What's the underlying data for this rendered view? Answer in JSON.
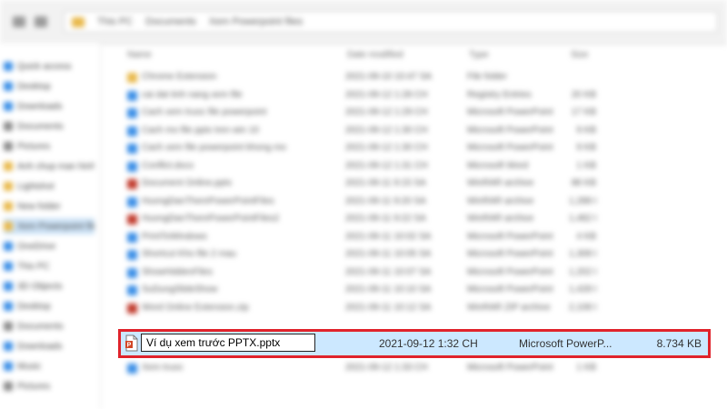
{
  "window": {
    "address_parts": [
      "This PC",
      "Documents",
      "Xem Powerpoint files"
    ],
    "search_placeholder": ""
  },
  "columns": {
    "name": "Name",
    "date": "Date modified",
    "type": "Type",
    "size": "Size"
  },
  "sidebar": {
    "items": [
      {
        "label": "Quick access",
        "color": "#3a8ee6"
      },
      {
        "label": "Desktop",
        "color": "#3a8ee6"
      },
      {
        "label": "Downloads",
        "color": "#3a8ee6"
      },
      {
        "label": "Documents",
        "color": "#8a8a8a"
      },
      {
        "label": "Pictures",
        "color": "#8a8a8a"
      },
      {
        "label": "Anh chup man hinh",
        "color": "#e8b84a"
      },
      {
        "label": "Lightshot",
        "color": "#e8b84a"
      },
      {
        "label": "New folder",
        "color": "#e8b84a"
      },
      {
        "label": "Xem Powerpoint files",
        "color": "#e8b84a"
      },
      {
        "label": "OneDrive",
        "color": "#3a8ee6"
      },
      {
        "label": "This PC",
        "color": "#3a8ee6"
      },
      {
        "label": "3D Objects",
        "color": "#3a8ee6"
      },
      {
        "label": "Desktop",
        "color": "#3a8ee6"
      },
      {
        "label": "Documents",
        "color": "#8a8a8a"
      },
      {
        "label": "Downloads",
        "color": "#3a8ee6"
      },
      {
        "label": "Music",
        "color": "#3a8ee6"
      },
      {
        "label": "Pictures",
        "color": "#8a8a8a"
      }
    ]
  },
  "files": [
    {
      "name": "Chrome Extension",
      "date": "2021-09-10 10:47 SA",
      "type": "File folder",
      "size": "",
      "color": "#e8b84a"
    },
    {
      "name": "cai dat tinh nang xem file",
      "date": "2021-09-12 1:28 CH",
      "type": "Registry Entries",
      "size": "20 KB",
      "color": "#3a8ee6"
    },
    {
      "name": "Cach xem truoc file powerpoint",
      "date": "2021-09-12 1:29 CH",
      "type": "Microsoft PowerPoint",
      "size": "17 KB",
      "color": "#3a8ee6"
    },
    {
      "name": "Cach mo file pptx tren win 10",
      "date": "2021-09-12 1:30 CH",
      "type": "Microsoft PowerPoint",
      "size": "9 KB",
      "color": "#3a8ee6"
    },
    {
      "name": "Cach xem file powerpoint khong mo",
      "date": "2021-09-12 1:30 CH",
      "type": "Microsoft PowerPoint",
      "size": "9 KB",
      "color": "#3a8ee6"
    },
    {
      "name": "Conflict.docx",
      "date": "2021-09-12 1:31 CH",
      "type": "Microsoft Word",
      "size": "1 KB",
      "color": "#3a8ee6"
    },
    {
      "name": "Document Online.pptx",
      "date": "2021-09-11 9:15 SA",
      "type": "WinRAR archive",
      "size": "88 KB",
      "color": "#c0392b"
    },
    {
      "name": "HuongDanThemPowerPointFiles",
      "date": "2021-09-11 9:20 SA",
      "type": "WinRAR archive",
      "size": "1,288 KB",
      "color": "#3a8ee6"
    },
    {
      "name": "HuongDanThemPowerPointFiles2",
      "date": "2021-09-11 9:22 SA",
      "type": "WinRAR archive",
      "size": "1,482 KB",
      "color": "#c0392b"
    },
    {
      "name": "PrintToWindows",
      "date": "2021-09-11 10:02 SA",
      "type": "Microsoft PowerPoint",
      "size": "4 KB",
      "color": "#3a8ee6"
    },
    {
      "name": "Shortcut Kho file 2 mau",
      "date": "2021-09-11 10:05 SA",
      "type": "Microsoft PowerPoint",
      "size": "1,308 KB",
      "color": "#3a8ee6"
    },
    {
      "name": "ShowHiddenFiles",
      "date": "2021-09-11 10:07 SA",
      "type": "Microsoft PowerPoint",
      "size": "1,202 KB",
      "color": "#3a8ee6"
    },
    {
      "name": "SuDungSlideShow",
      "date": "2021-09-11 10:10 SA",
      "type": "Microsoft PowerPoint",
      "size": "1,428 KB",
      "color": "#3a8ee6"
    },
    {
      "name": "Word Online Extension.zip",
      "date": "2021-09-11 10:12 SA",
      "type": "WinRAR ZIP archive",
      "size": "2,108 KB",
      "color": "#c0392b"
    }
  ],
  "selected_file": {
    "name": "Ví dụ xem trước PPTX.pptx",
    "date": "2021-09-12 1:32 CH",
    "type": "Microsoft PowerP...",
    "size": "8.734 KB"
  },
  "after_files": [
    {
      "name": "Xem truoc",
      "date": "2021-09-12 1:33 CH",
      "type": "Microsoft PowerPoint",
      "size": "1 KB",
      "color": "#3a8ee6"
    }
  ],
  "colors": {
    "highlight_border": "#e0232b",
    "selection_fill": "#cce8ff"
  }
}
